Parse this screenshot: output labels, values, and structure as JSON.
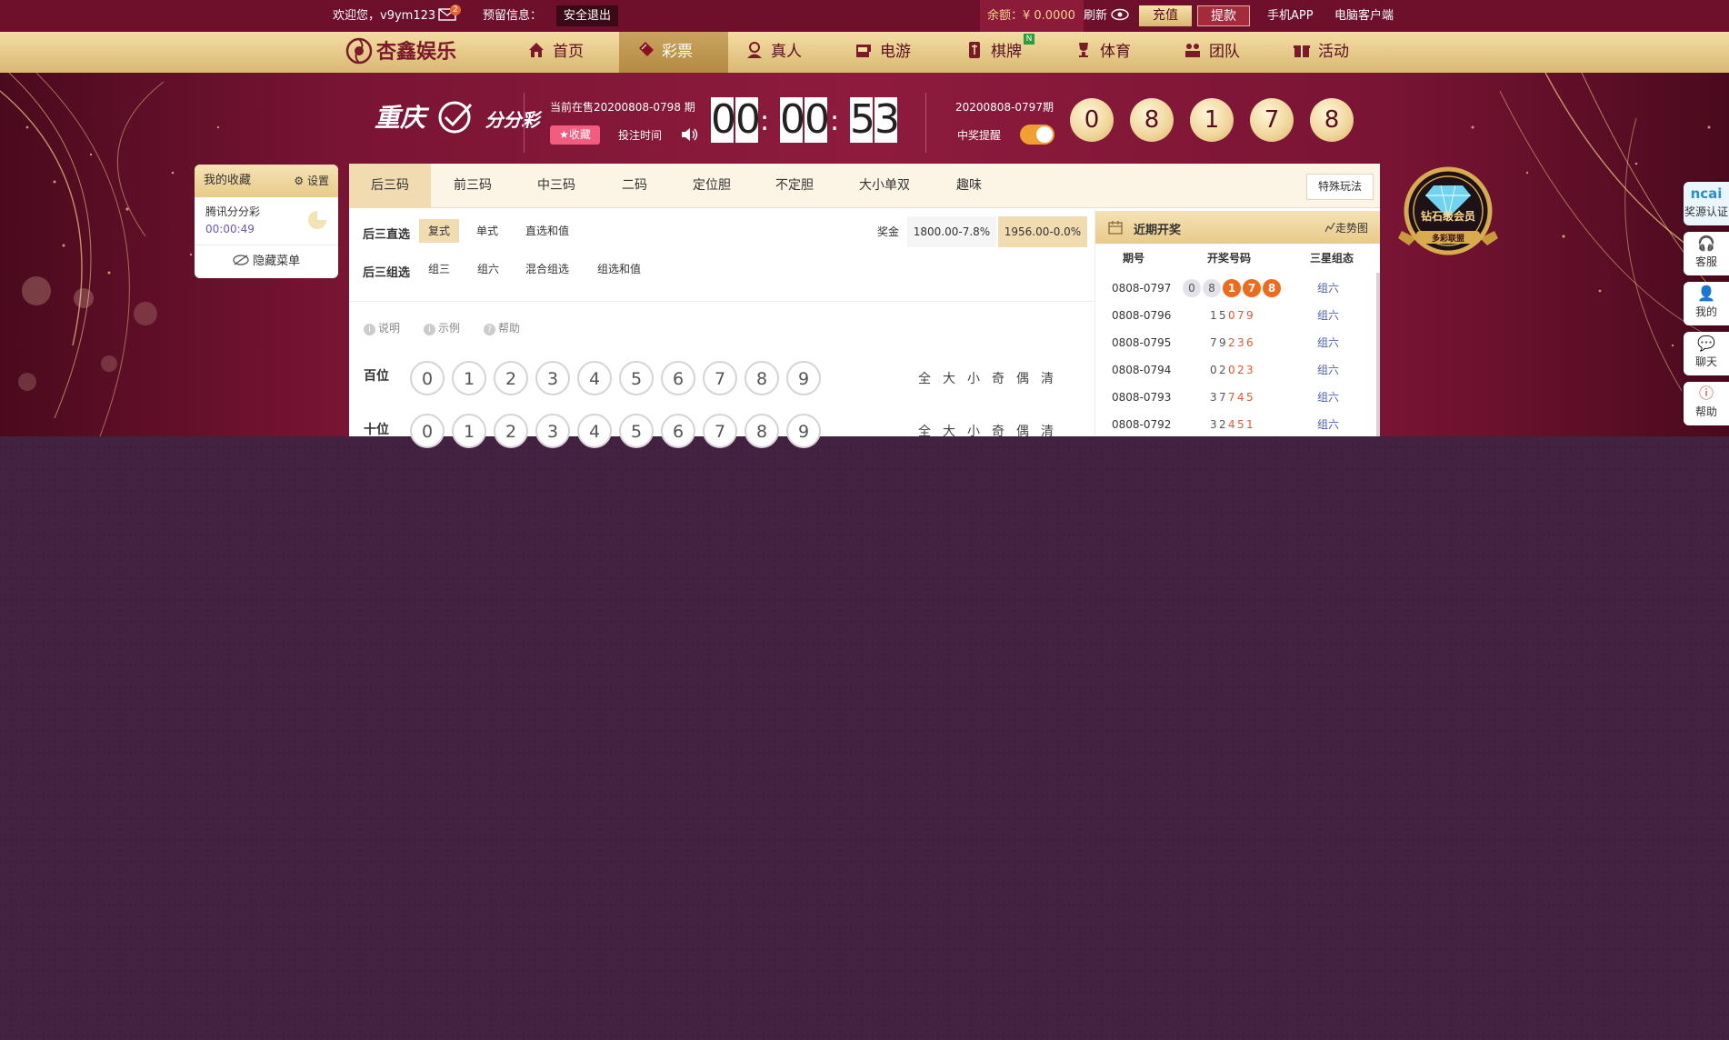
{
  "topbar": {
    "welcome": "欢迎您，v9ym123",
    "mail_count": "2",
    "notice_label": "预留信息：",
    "logout": "安全退出",
    "balance": "余额：¥ 0.0000",
    "refresh": "刷新",
    "recharge": "充值",
    "withdraw": "提款",
    "mobile_app": "手机APP",
    "pc_client": "电脑客户端"
  },
  "nav": {
    "logo": "杏鑫娱乐",
    "items": [
      "首页",
      "彩票",
      "真人",
      "电游",
      "棋牌",
      "体育",
      "团队",
      "活动"
    ],
    "new_badge": "N",
    "active_index": 1
  },
  "lottery": {
    "name": "重庆",
    "name_suffix": "分分彩",
    "current_label": "当前在售20200808-0798 期",
    "favorite": "★收藏",
    "bet_time": "投注时间",
    "countdown": [
      "0",
      "0",
      "0",
      "0",
      "5",
      "3"
    ],
    "last_issue": "20200808-0797期",
    "win_remind": "中奖提醒",
    "last_numbers": [
      "0",
      "8",
      "1",
      "7",
      "8"
    ]
  },
  "favorites": {
    "title": "我的收藏",
    "settings": "设置",
    "item_name": "腾讯分分彩",
    "item_time": "00:00:49",
    "hide_menu": "隐藏菜单"
  },
  "tabs": [
    "后三码",
    "前三码",
    "中三码",
    "二码",
    "定位胆",
    "不定胆",
    "大小单双",
    "趣味"
  ],
  "special_play": "特殊玩法",
  "play": {
    "direct_label": "后三直选",
    "direct_options": [
      "复式",
      "单式",
      "直选和值"
    ],
    "group_label": "后三组选",
    "group_options": [
      "组三",
      "组六",
      "混合组选",
      "组选和值"
    ],
    "prize_label": "奖金",
    "prize1": "1800.00-7.8%",
    "prize2": "1956.00-0.0%"
  },
  "help_links": [
    "说明",
    "示例",
    "帮助"
  ],
  "positions": [
    {
      "label": "百位"
    },
    {
      "label": "十位"
    }
  ],
  "digits": [
    "0",
    "1",
    "2",
    "3",
    "4",
    "5",
    "6",
    "7",
    "8",
    "9"
  ],
  "quick_ops": [
    "全",
    "大",
    "小",
    "奇",
    "偶",
    "清"
  ],
  "history": {
    "title": "近期开奖",
    "trend": "走势图",
    "col_issue": "期号",
    "col_numbers": "开奖号码",
    "col_type": "三星组态",
    "rows": [
      {
        "issue": "0808-0797",
        "nums": [
          "0",
          "8",
          "1",
          "7",
          "8"
        ],
        "type": "组六"
      },
      {
        "issue": "0808-0796",
        "nums": [
          "1",
          "5",
          "0",
          "7",
          "9"
        ],
        "type": "组六"
      },
      {
        "issue": "0808-0795",
        "nums": [
          "7",
          "9",
          "2",
          "3",
          "6"
        ],
        "type": "组六"
      },
      {
        "issue": "0808-0794",
        "nums": [
          "0",
          "2",
          "0",
          "2",
          "3"
        ],
        "type": "组六"
      },
      {
        "issue": "0808-0793",
        "nums": [
          "3",
          "7",
          "7",
          "4",
          "5"
        ],
        "type": "组六"
      },
      {
        "issue": "0808-0792",
        "nums": [
          "3",
          "2",
          "4",
          "5",
          "1"
        ],
        "type": "组六"
      }
    ]
  },
  "vip": {
    "title": "钻石级会员",
    "subtitle": "多彩联盟"
  },
  "sidebar": [
    "奖源认证",
    "客服",
    "我的",
    "聊天",
    "帮助"
  ],
  "sidebar_logo": "ncai"
}
